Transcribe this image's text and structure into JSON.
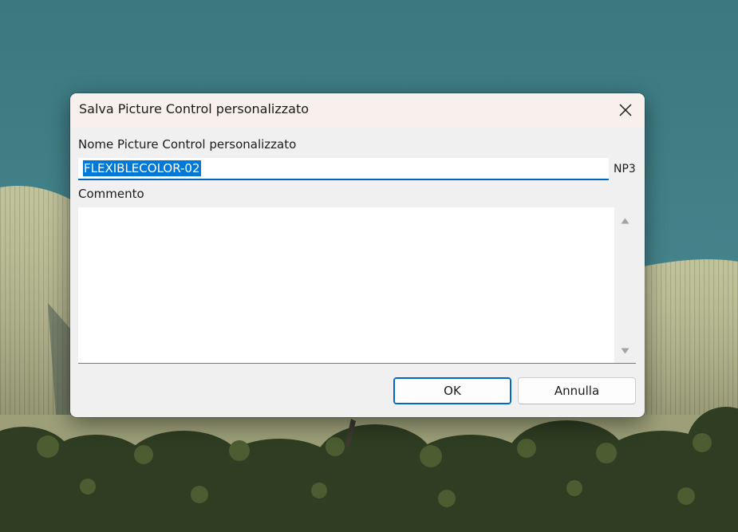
{
  "dialog": {
    "title": "Salva Picture Control personalizzato",
    "name_label": "Nome Picture Control personalizzato",
    "name_value": "FLEXIBLECOLOR-02",
    "extension": "NP3",
    "comment_label": "Commento",
    "comment_value": "",
    "ok_label": "OK",
    "cancel_label": "Annulla"
  },
  "colors": {
    "accent": "#0067c0",
    "selection": "#0078d7",
    "sky": "#3f7e86",
    "dome": "#b7b98a",
    "foliage": "#2d3a1f"
  }
}
